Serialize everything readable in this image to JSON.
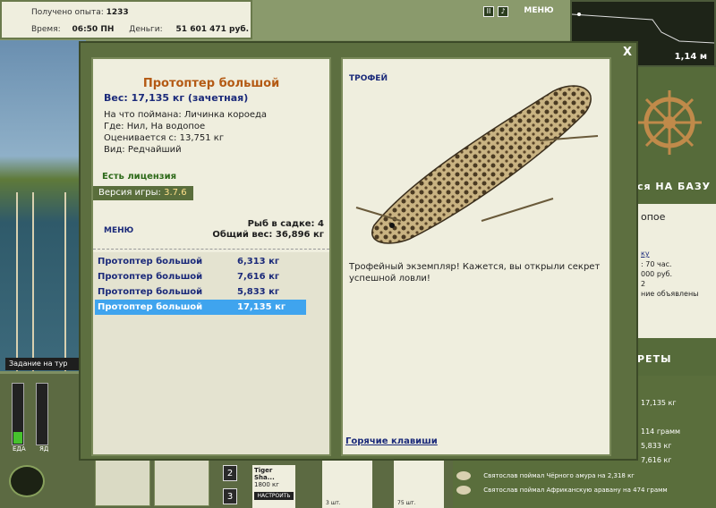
{
  "stats": {
    "exp_label": "Получено опыта:",
    "exp_value": "1233",
    "time_label": "Время:",
    "time_value": "06:50 ПН",
    "money_label": "Деньги:",
    "money_value": "51 601 471 руб."
  },
  "top_menu_label": "МЕНЮ",
  "depth_value": "1,14 м",
  "task_bar": "Задание на тур",
  "meters": {
    "left_label": "ЕДА",
    "right_label": "ЯД",
    "left_level": 0.2
  },
  "tiger": {
    "name": "Tiger Sha...",
    "weight": "1800 кг",
    "button": "НАСТРОИТЬ"
  },
  "slots": [
    "2",
    "3"
  ],
  "lures": [
    {
      "qty": "3 шт."
    },
    {
      "qty": "75 шт."
    }
  ],
  "right_panel": {
    "base_heading": "ся НА БАЗУ",
    "lake_partial": "опое",
    "link_partial": "ку",
    "hours": ": 70 час.",
    "price": "000 руб.",
    "count": "2",
    "ads": "ние объявлены",
    "secrets_heading": "РЕТЫ",
    "news_values": [
      "17,135 кг",
      "114 грамм",
      "5,833 кг",
      "7,616 кг"
    ]
  },
  "news": [
    {
      "text": "Святослав поймал Чёрного амура на 2,318 кг"
    },
    {
      "text": "Святослав поймал Африканскую аравану на 474 грамм"
    }
  ],
  "modal": {
    "close_label": "X",
    "fish_title": "Протоптер большой",
    "weight_line": "Вес: 17,135 кг (зачетная)",
    "bait_line": "На что поймана: Личинка короеда",
    "place_line": "Где: Нил, На водопое",
    "value_line": "Оценивается с: 13,751 кг",
    "rarity_line": "Вид: Редчайший",
    "license": "Есть лицензия",
    "version_label": "Версия игры:",
    "version_value": "3.7.6",
    "menu_link": "МЕНЮ",
    "keep_count": "Рыб в садке: 4",
    "total_weight": "Общий вес: 36,896 кг",
    "catches": [
      {
        "name": "Протоптер большой",
        "weight": "6,313 кг",
        "selected": false
      },
      {
        "name": "Протоптер большой",
        "weight": "7,616 кг",
        "selected": false
      },
      {
        "name": "Протоптер большой",
        "weight": "5,833 кг",
        "selected": false
      },
      {
        "name": "Протоптер большой",
        "weight": "17,135 кг",
        "selected": true
      }
    ],
    "trophy_label": "ТРОФЕЙ",
    "trophy_text": "Трофейный экземпляр! Кажется, вы открыли секрет успешной ловли!",
    "hotkeys": "Горячие клавиши"
  }
}
